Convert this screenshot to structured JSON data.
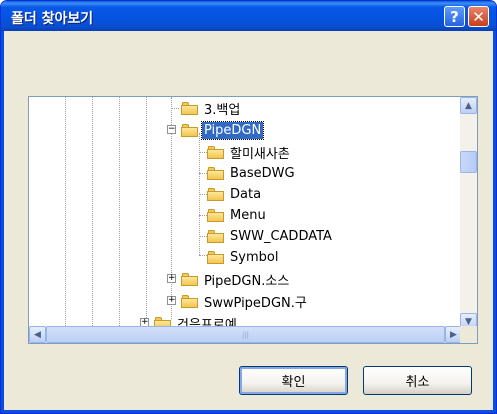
{
  "window": {
    "title": "폴더 찾아보기"
  },
  "titlebar": {
    "help_glyph": "?",
    "close_glyph": "✕"
  },
  "tree": {
    "items": [
      {
        "label": "3.백업",
        "expander": "",
        "selected": false,
        "icon": "folder-icon"
      },
      {
        "label": "PipeDGN",
        "expander": "−",
        "selected": true,
        "icon": "folder-open-icon"
      },
      {
        "label": "할미새사촌",
        "expander": "",
        "selected": false,
        "icon": "folder-icon"
      },
      {
        "label": "BaseDWG",
        "expander": "",
        "selected": false,
        "icon": "folder-icon"
      },
      {
        "label": "Data",
        "expander": "",
        "selected": false,
        "icon": "folder-icon"
      },
      {
        "label": "Menu",
        "expander": "",
        "selected": false,
        "icon": "folder-icon"
      },
      {
        "label": "SWW_CADDATA",
        "expander": "",
        "selected": false,
        "icon": "folder-icon"
      },
      {
        "label": "Symbol",
        "expander": "",
        "selected": false,
        "icon": "folder-icon"
      },
      {
        "label": "PipeDGN.소스",
        "expander": "+",
        "selected": false,
        "icon": "folder-icon"
      },
      {
        "label": "SwwPipeDGN.구",
        "expander": "+",
        "selected": false,
        "icon": "folder-icon"
      },
      {
        "label": "건음프로예",
        "expander": "+",
        "selected": false,
        "icon": "folder-icon"
      }
    ]
  },
  "scroll": {
    "up": "▲",
    "down": "▼",
    "left": "◀",
    "right": "▶",
    "grip": "|||"
  },
  "buttons": {
    "ok": "확인",
    "cancel": "취소"
  }
}
